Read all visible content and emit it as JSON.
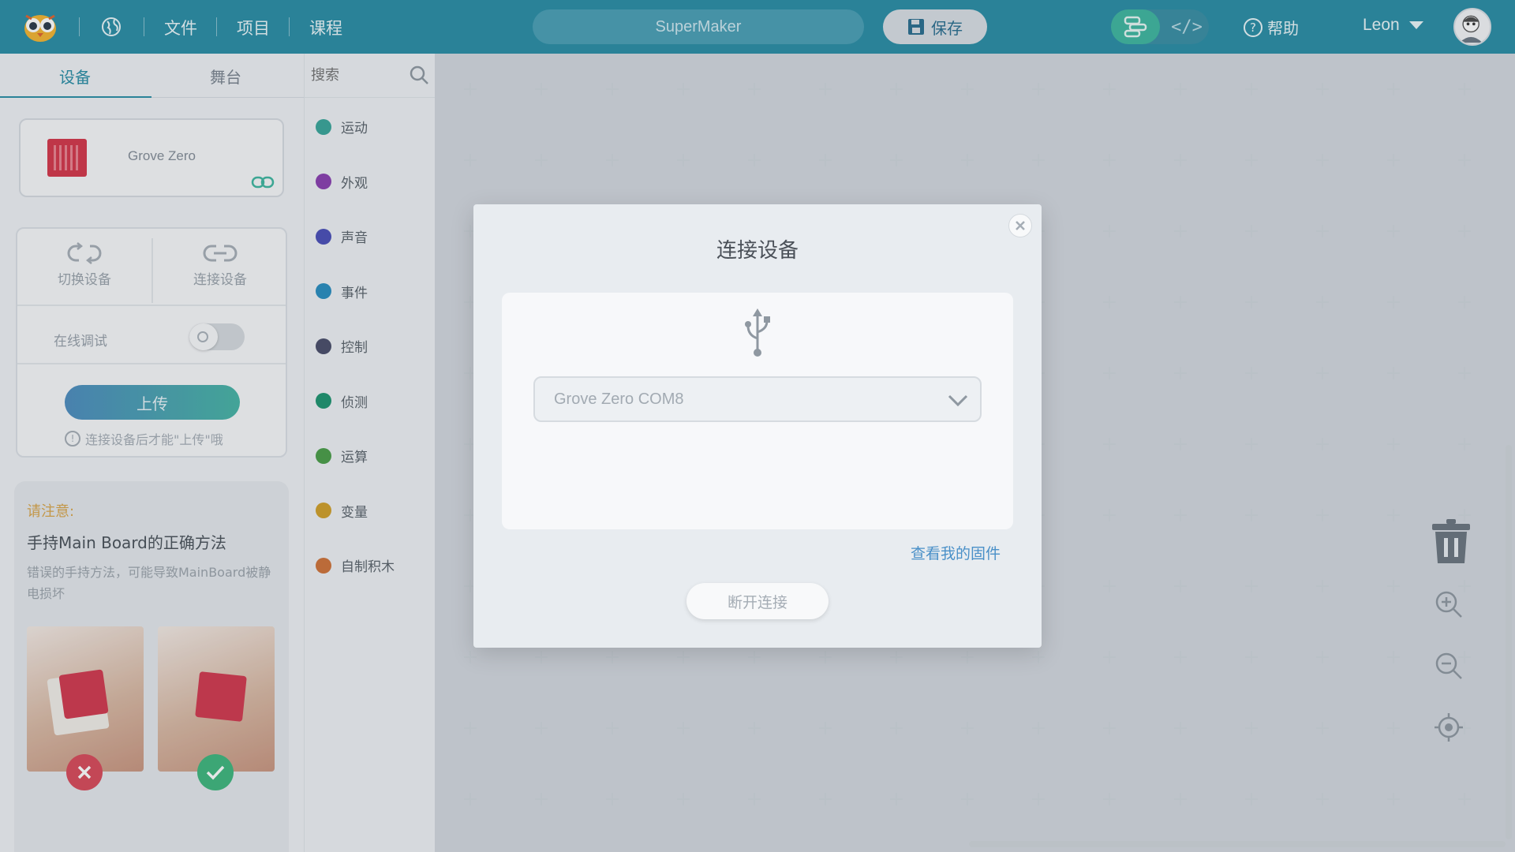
{
  "app": {
    "project_name": "SuperMaker"
  },
  "topbar": {
    "menu": [
      "文件",
      "项目",
      "课程"
    ],
    "save_label": "保存",
    "help_label": "帮助",
    "user_name": "Leon"
  },
  "left_panel": {
    "tabs": [
      "设备",
      "舞台"
    ],
    "active_tab": 0,
    "device": {
      "name": "Grove Zero"
    },
    "switch_device": "切换设备",
    "connect_device": "连接设备",
    "online_debug": "在线调试",
    "upload": "上传",
    "upload_hint": "连接设备后才能\"上传\"哦",
    "notice": {
      "title": "请注意:",
      "heading": "手持Main Board的正确方法",
      "desc": "错误的手持方法，可能导致MainBoard被静电损坏"
    }
  },
  "categories": {
    "search_placeholder": "搜索",
    "items": [
      {
        "label": "运动",
        "color": "#3aa69a"
      },
      {
        "label": "外观",
        "color": "#8a3fb0"
      },
      {
        "label": "声音",
        "color": "#4a4fb8"
      },
      {
        "label": "事件",
        "color": "#2a8ec0"
      },
      {
        "label": "控制",
        "color": "#4a4e6a"
      },
      {
        "label": "侦测",
        "color": "#1e9470"
      },
      {
        "label": "运算",
        "color": "#4a9e48"
      },
      {
        "label": "变量",
        "color": "#d1a02a"
      },
      {
        "label": "自制积木",
        "color": "#d0733a"
      }
    ]
  },
  "modal": {
    "title": "连接设备",
    "port": "Grove Zero COM8",
    "firmware_link": "查看我的固件",
    "disconnect": "断开连接"
  },
  "colors": {
    "accent": "#2b8ea6",
    "warning": "#d9a54a",
    "link": "#4a90c8"
  }
}
